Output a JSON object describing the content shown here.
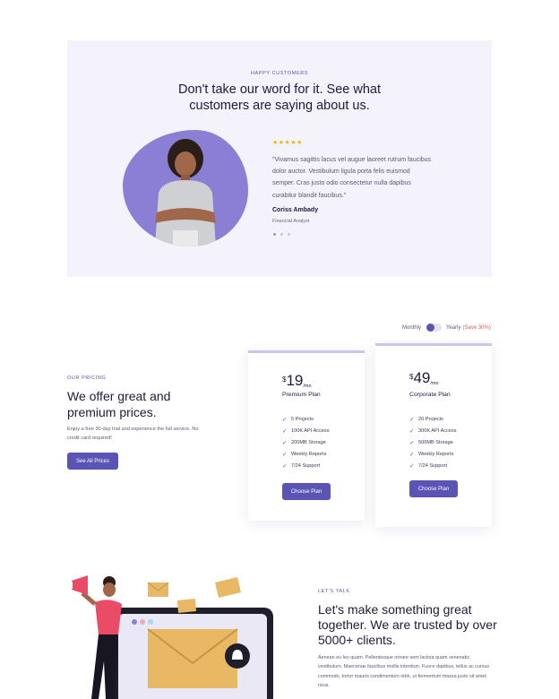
{
  "testimonials": {
    "eyebrow": "HAPPY CUSTOMERS",
    "title": "Don't take our word for it. See what customers are saying about us.",
    "stars": "★★★★★",
    "quote": "\"Vivamus sagittis lacus vel augue laoreet rutrum faucibus dolor auctor. Vestibulum ligula porta felis euismod semper. Cras justo odio consectetur nulla dapibus curabitur blandit faucibus.\"",
    "author": "Coriss Ambady",
    "role": "Financial Analyst"
  },
  "pricing": {
    "toggle": {
      "monthly": "Monthly",
      "yearly": "Yearly",
      "save": "(Save 30%)"
    },
    "eyebrow": "OUR PRICING",
    "title": "We offer great and premium prices.",
    "desc": "Enjoy a free 30-day trial and experience the full service. No credit card required!",
    "cta": "See All Prices",
    "plans": [
      {
        "currency": "$",
        "price": "19",
        "period": "/mo",
        "name": "Premium Plan",
        "features": [
          "5 Projects",
          "100K API Access",
          "200MB Storage",
          "Weekly Reports",
          "7/24 Support"
        ],
        "button": "Choose Plan"
      },
      {
        "currency": "$",
        "price": "49",
        "period": "/mo",
        "name": "Corporate Plan",
        "features": [
          "20 Projects",
          "300K API Access",
          "500MB Storage",
          "Weekly Reports",
          "7/24 Support"
        ],
        "button": "Choose Plan"
      }
    ]
  },
  "contact": {
    "eyebrow": "LET'S TALK",
    "title": "Let's make something great together. We are trusted by over 5000+ clients.",
    "desc": "Aenean eu leo quam. Pellentesque ornare sem lacinia quam venenatis vestibulum. Maecenas faucibus mollis interdum. Fusce dapibus, tellus ac cursus commodo, tortor mauris condimentum nibh, ut fermentum massa justo sit amet risus."
  },
  "colors": {
    "accent": "#5a54b4",
    "bg_soft": "#f4f2fb",
    "star": "#f5b301",
    "save": "#e85b5b"
  }
}
